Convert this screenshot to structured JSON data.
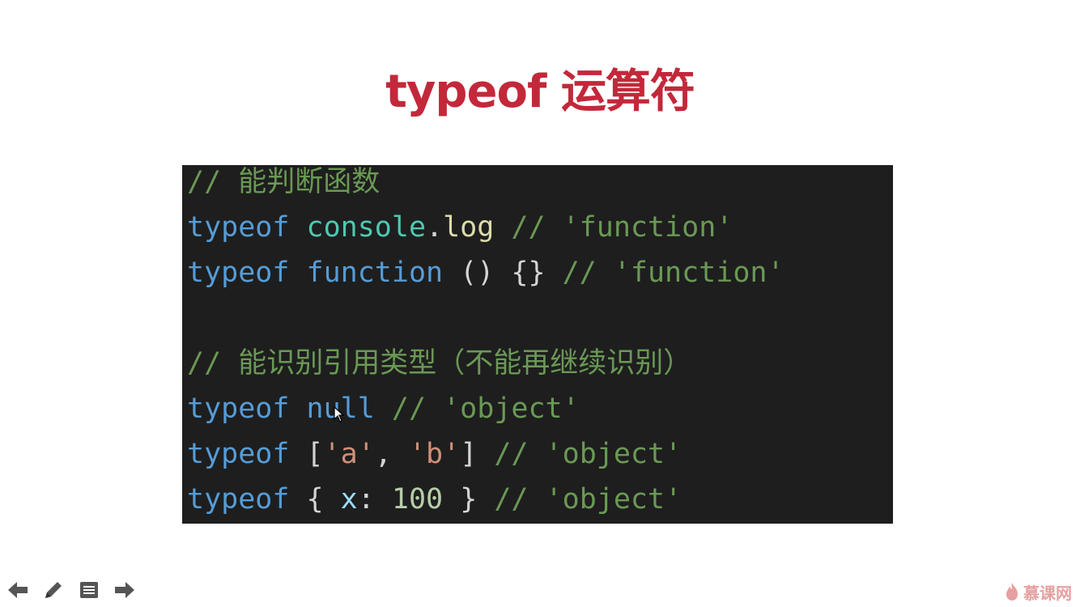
{
  "slide": {
    "title": "typeof 运算符"
  },
  "code": {
    "lines": [
      [
        {
          "t": "cm",
          "v": "// 能判断函数"
        }
      ],
      [
        {
          "t": "kw",
          "v": "typeof "
        },
        {
          "t": "obj",
          "v": "console"
        },
        {
          "t": "punc",
          "v": "."
        },
        {
          "t": "fn",
          "v": "log"
        },
        {
          "t": "cm",
          "v": " // 'function'"
        }
      ],
      [
        {
          "t": "kw",
          "v": "typeof "
        },
        {
          "t": "kw",
          "v": "function"
        },
        {
          "t": "punc",
          "v": " () {}"
        },
        {
          "t": "cm",
          "v": " // 'function'"
        }
      ],
      [],
      [
        {
          "t": "cm",
          "v": "// 能识别引用类型（不能再继续识别）"
        }
      ],
      [
        {
          "t": "kw",
          "v": "typeof "
        },
        {
          "t": "kw",
          "v": "null"
        },
        {
          "t": "cm",
          "v": " // 'object'"
        }
      ],
      [
        {
          "t": "kw",
          "v": "typeof "
        },
        {
          "t": "punc",
          "v": "["
        },
        {
          "t": "str",
          "v": "'a'"
        },
        {
          "t": "punc",
          "v": ", "
        },
        {
          "t": "str",
          "v": "'b'"
        },
        {
          "t": "punc",
          "v": "]"
        },
        {
          "t": "cm",
          "v": " // 'object'"
        }
      ],
      [
        {
          "t": "kw",
          "v": "typeof "
        },
        {
          "t": "punc",
          "v": "{ "
        },
        {
          "t": "prop",
          "v": "x"
        },
        {
          "t": "punc",
          "v": ": "
        },
        {
          "t": "num",
          "v": "100"
        },
        {
          "t": "punc",
          "v": " }"
        },
        {
          "t": "cm",
          "v": " // 'object'"
        }
      ]
    ]
  },
  "toolbar": {
    "items": [
      {
        "name": "previous-slide-button",
        "icon": "arrow-left-icon"
      },
      {
        "name": "pen-tool-button",
        "icon": "pencil-icon"
      },
      {
        "name": "slide-menu-button",
        "icon": "menu-list-icon"
      },
      {
        "name": "next-slide-button",
        "icon": "arrow-right-icon"
      }
    ]
  },
  "brand": {
    "text": "慕课网",
    "icon": "flame-logo-icon"
  },
  "colors": {
    "title": "#c3283a",
    "code_bg": "#1e1e1e",
    "keyword": "#569cd6",
    "comment": "#6a9955",
    "string": "#ce9178",
    "toolbar_icon": "#555555"
  }
}
